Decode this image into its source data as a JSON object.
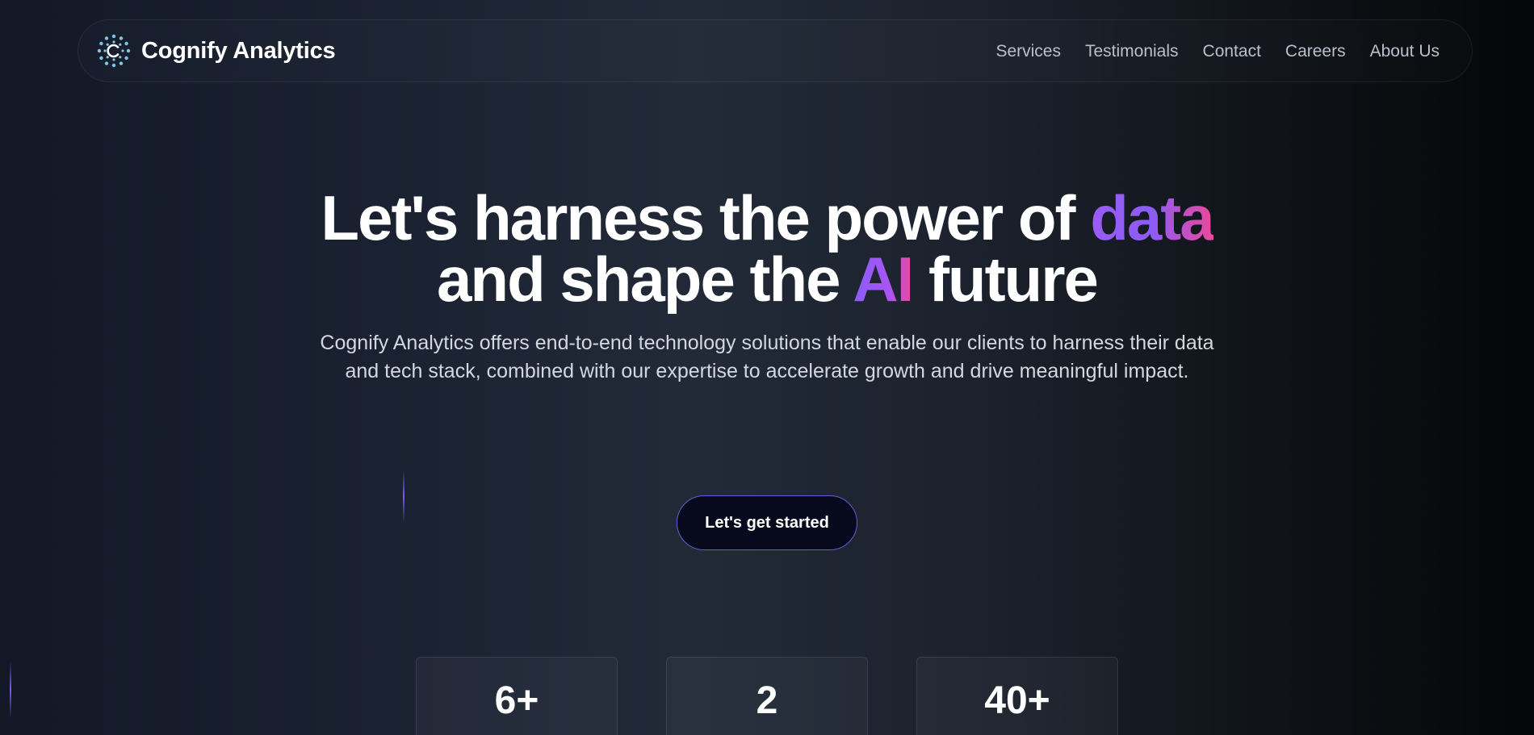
{
  "brand": {
    "name": "Cognify Analytics",
    "logo_icon": "c-dots-logo-icon",
    "accent_color": "#8b5cf6"
  },
  "nav": {
    "links": [
      "Services",
      "Testimonials",
      "Contact",
      "Careers",
      "About Us"
    ]
  },
  "hero": {
    "headline_line1_start": "Let's harness the power of ",
    "headline_line1_highlight": "data",
    "headline_line2_start": "and shape the ",
    "headline_line2_highlight": "AI",
    "headline_line2_end": " future",
    "subtext": "Cognify Analytics offers end-to-end technology solutions that enable our clients to harness their data and tech stack, combined with our expertise to accelerate growth and drive meaningful impact.",
    "cta_label": "Let's get started",
    "highlight_gradient": [
      "#8b5cf6",
      "#ec4899"
    ]
  },
  "stats": [
    "6+",
    "2",
    "40+"
  ]
}
